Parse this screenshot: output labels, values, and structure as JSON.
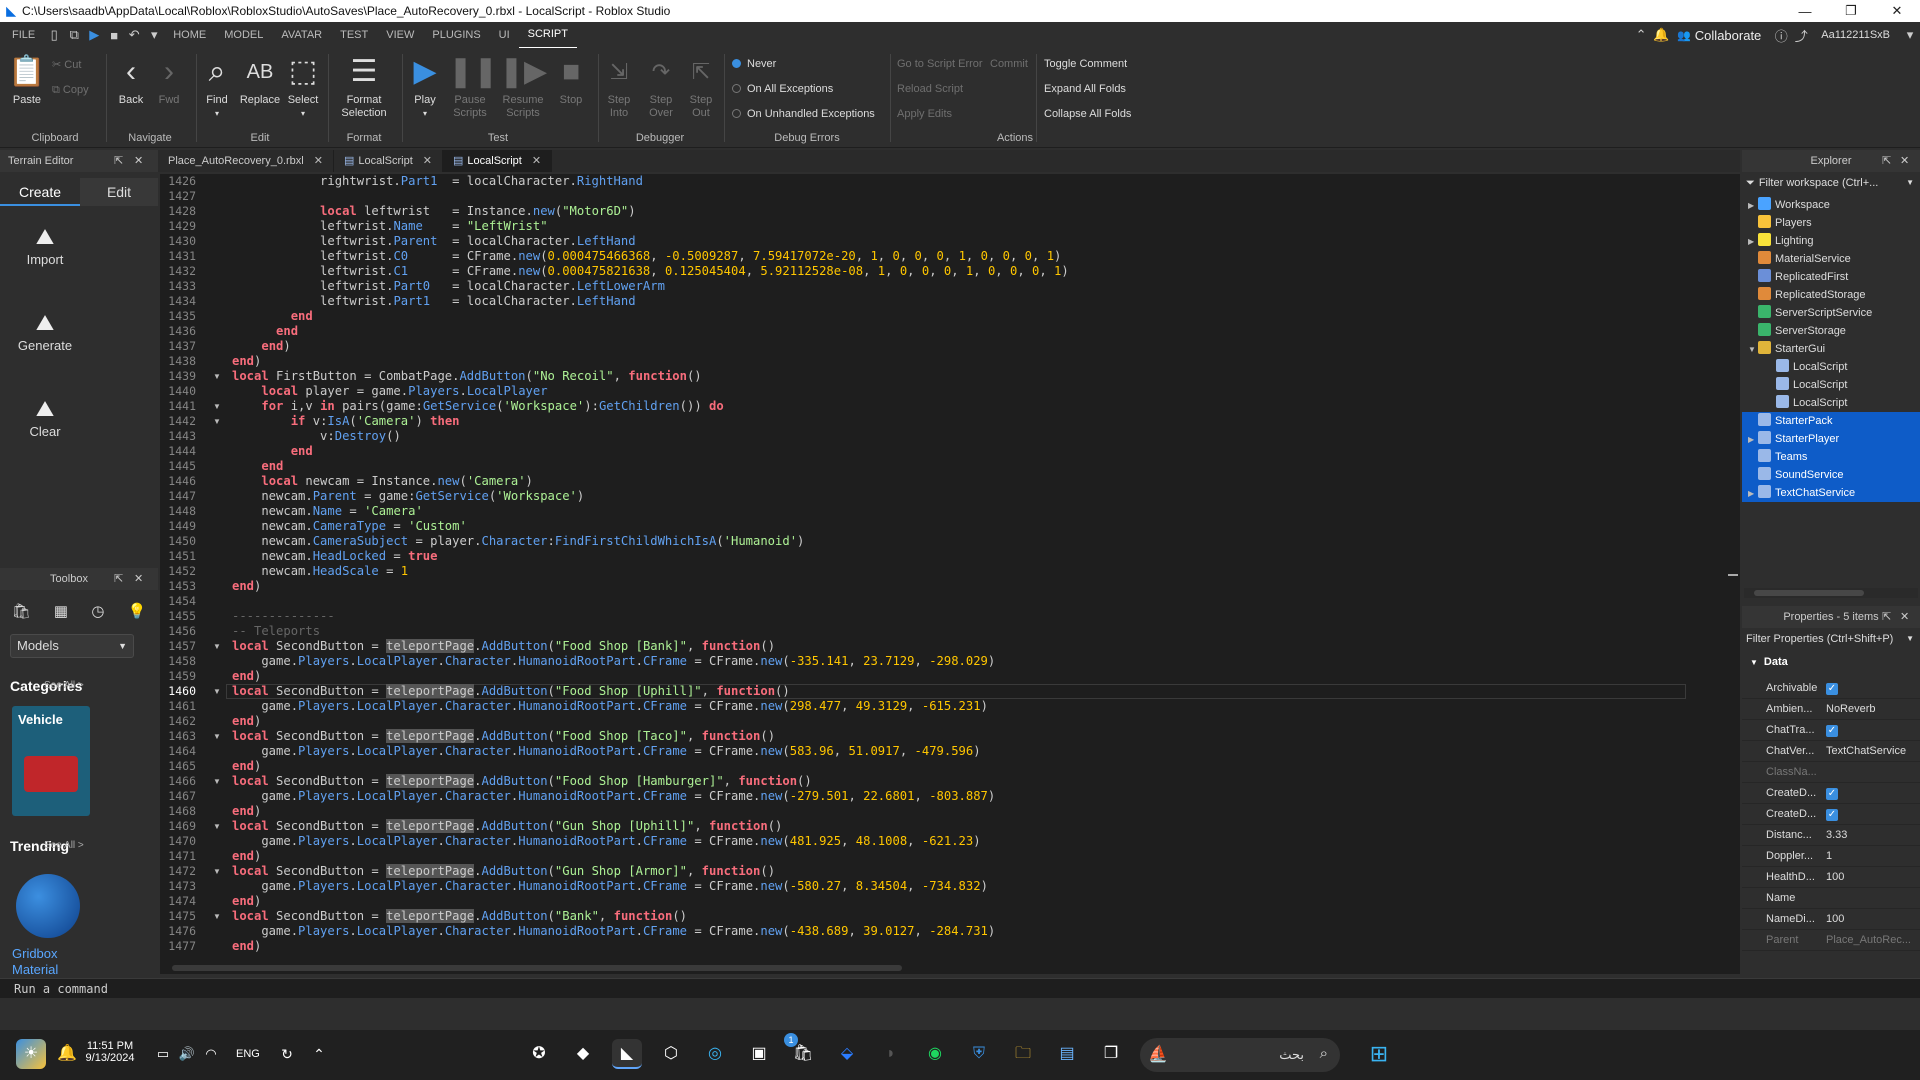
{
  "window": {
    "title": "C:\\Users\\saadb\\AppData\\Local\\Roblox\\RobloxStudio\\AutoSaves\\Place_AutoRecovery_0.rbxl - LocalScript - Roblox Studio"
  },
  "menu": {
    "file": "FILE",
    "items": [
      "HOME",
      "MODEL",
      "AVATAR",
      "TEST",
      "VIEW",
      "PLUGINS",
      "UI",
      "SCRIPT"
    ],
    "collaborate": "Collaborate",
    "user": "Aa112211SxB"
  },
  "ribbon": {
    "paste": "Paste",
    "cut": "Cut",
    "copy": "Copy",
    "clipboard": "Clipboard",
    "back": "Back",
    "fwd": "Fwd",
    "navigate": "Navigate",
    "find": "Find",
    "replace": "Replace",
    "select": "Select",
    "edit": "Edit",
    "format_selection_1": "Format",
    "format_selection_2": "Selection",
    "format": "Format",
    "play": "Play",
    "pause_1": "Pause",
    "pause_2": "Scripts",
    "resume_1": "Resume",
    "resume_2": "Scripts",
    "stop": "Stop",
    "test": "Test",
    "step_into_1": "Step",
    "step_into_2": "Into",
    "step_over_1": "Step",
    "step_over_2": "Over",
    "step_out_1": "Step",
    "step_out_2": "Out",
    "debugger": "Debugger",
    "never": "Never",
    "on_all": "On All Exceptions",
    "on_unhandled": "On Unhandled Exceptions",
    "debug_errors": "Debug Errors",
    "go_to_error": "Go to Script Error",
    "commit": "Commit",
    "reload": "Reload Script",
    "apply": "Apply Edits",
    "toggle_comment": "Toggle Comment",
    "expand": "Expand All Folds",
    "collapse": "Collapse All Folds",
    "actions": "Actions"
  },
  "terrain": {
    "title": "Terrain Editor",
    "create": "Create",
    "edit": "Edit",
    "import": "Import",
    "generate": "Generate",
    "clear": "Clear"
  },
  "toolbox": {
    "title": "Toolbox",
    "models": "Models",
    "categories": "Categories",
    "see_all_1": "See All >",
    "vehicle": "Vehicle",
    "trending": "Trending",
    "see_all_2": "See All >",
    "gridbox_1": "Gridbox",
    "gridbox_2": "Material"
  },
  "tabs": [
    "Place_AutoRecovery_0.rbxl",
    "LocalScript",
    "LocalScript"
  ],
  "editor": {
    "line_numbers": [
      "1426",
      "1427",
      "1428",
      "1429",
      "1430",
      "1431",
      "1432",
      "1433",
      "1434",
      "1435",
      "1436",
      "1437",
      "1438",
      "1439",
      "1440",
      "1441",
      "1442",
      "1443",
      "1444",
      "1445",
      "1446",
      "1447",
      "1448",
      "1449",
      "1450",
      "1451",
      "1452",
      "1453",
      "1454",
      "1455",
      "1456",
      "1457",
      "1458",
      "1459",
      "1460",
      "1461",
      "1462",
      "1463",
      "1464",
      "1465",
      "1466",
      "1467",
      "1468",
      "1469",
      "1470",
      "1471",
      "1472",
      "1473",
      "1474",
      "1475",
      "1476",
      "1477"
    ],
    "teleports": [
      {
        "name": "\"Food Shop [Bank]\"",
        "cf": "-335.141, 23.7129, -298.029"
      },
      {
        "name": "\"Food Shop [Uphill]\"",
        "cf": "298.477, 49.3129, -615.231"
      },
      {
        "name": "\"Food Shop [Taco]\"",
        "cf": "583.96, 51.0917, -479.596"
      },
      {
        "name": "\"Food Shop [Hamburger]\"",
        "cf": "-279.501, 22.6801, -803.887"
      },
      {
        "name": "\"Gun Shop [Uphill]\"",
        "cf": "481.925, 48.1008, -621.23"
      },
      {
        "name": "\"Gun Shop [Armor]\"",
        "cf": "-580.27, 8.34504, -734.832"
      },
      {
        "name": "\"Bank\"",
        "cf": "-438.689, 39.0127, -284.731"
      }
    ]
  },
  "explorer": {
    "title": "Explorer",
    "filter": "Filter workspace (Ctrl+...",
    "items": [
      "Workspace",
      "Players",
      "Lighting",
      "MaterialService",
      "ReplicatedFirst",
      "ReplicatedStorage",
      "ServerScriptService",
      "ServerStorage",
      "StarterGui",
      "LocalScript",
      "LocalScript",
      "LocalScript",
      "StarterPack",
      "StarterPlayer",
      "Teams",
      "SoundService",
      "TextChatService"
    ]
  },
  "properties": {
    "title": "Properties - 5 items",
    "filter": "Filter Properties (Ctrl+Shift+P)",
    "section": "Data",
    "rows": [
      {
        "name": "Archivable",
        "value": "",
        "check": true
      },
      {
        "name": "Ambien...",
        "value": "NoReverb",
        "check": false
      },
      {
        "name": "ChatTra...",
        "value": "",
        "check": true
      },
      {
        "name": "ChatVer...",
        "value": "TextChatService",
        "check": false
      },
      {
        "name": "ClassNa...",
        "value": "",
        "check": false
      },
      {
        "name": "CreateD...",
        "value": "",
        "check": true
      },
      {
        "name": "CreateD...",
        "value": "",
        "check": true
      },
      {
        "name": "Distanc...",
        "value": "3.33",
        "check": false
      },
      {
        "name": "Doppler...",
        "value": "1",
        "check": false
      },
      {
        "name": "HealthD...",
        "value": "100",
        "check": false
      },
      {
        "name": "Name",
        "value": "",
        "check": false
      },
      {
        "name": "NameDi...",
        "value": "100",
        "check": false
      },
      {
        "name": "Parent",
        "value": "Place_AutoRec...",
        "check": false
      }
    ]
  },
  "command": {
    "placeholder": "Run a command"
  },
  "taskbar": {
    "time": "11:51 PM",
    "date": "9/13/2024",
    "lang": "ENG",
    "search": "بحث",
    "badge": "1"
  },
  "colors": {
    "keyword": "#f86d7c",
    "property": "#61a1f1",
    "string": "#adf195",
    "number": "#ffc600",
    "selection": "#0e5cc8"
  }
}
